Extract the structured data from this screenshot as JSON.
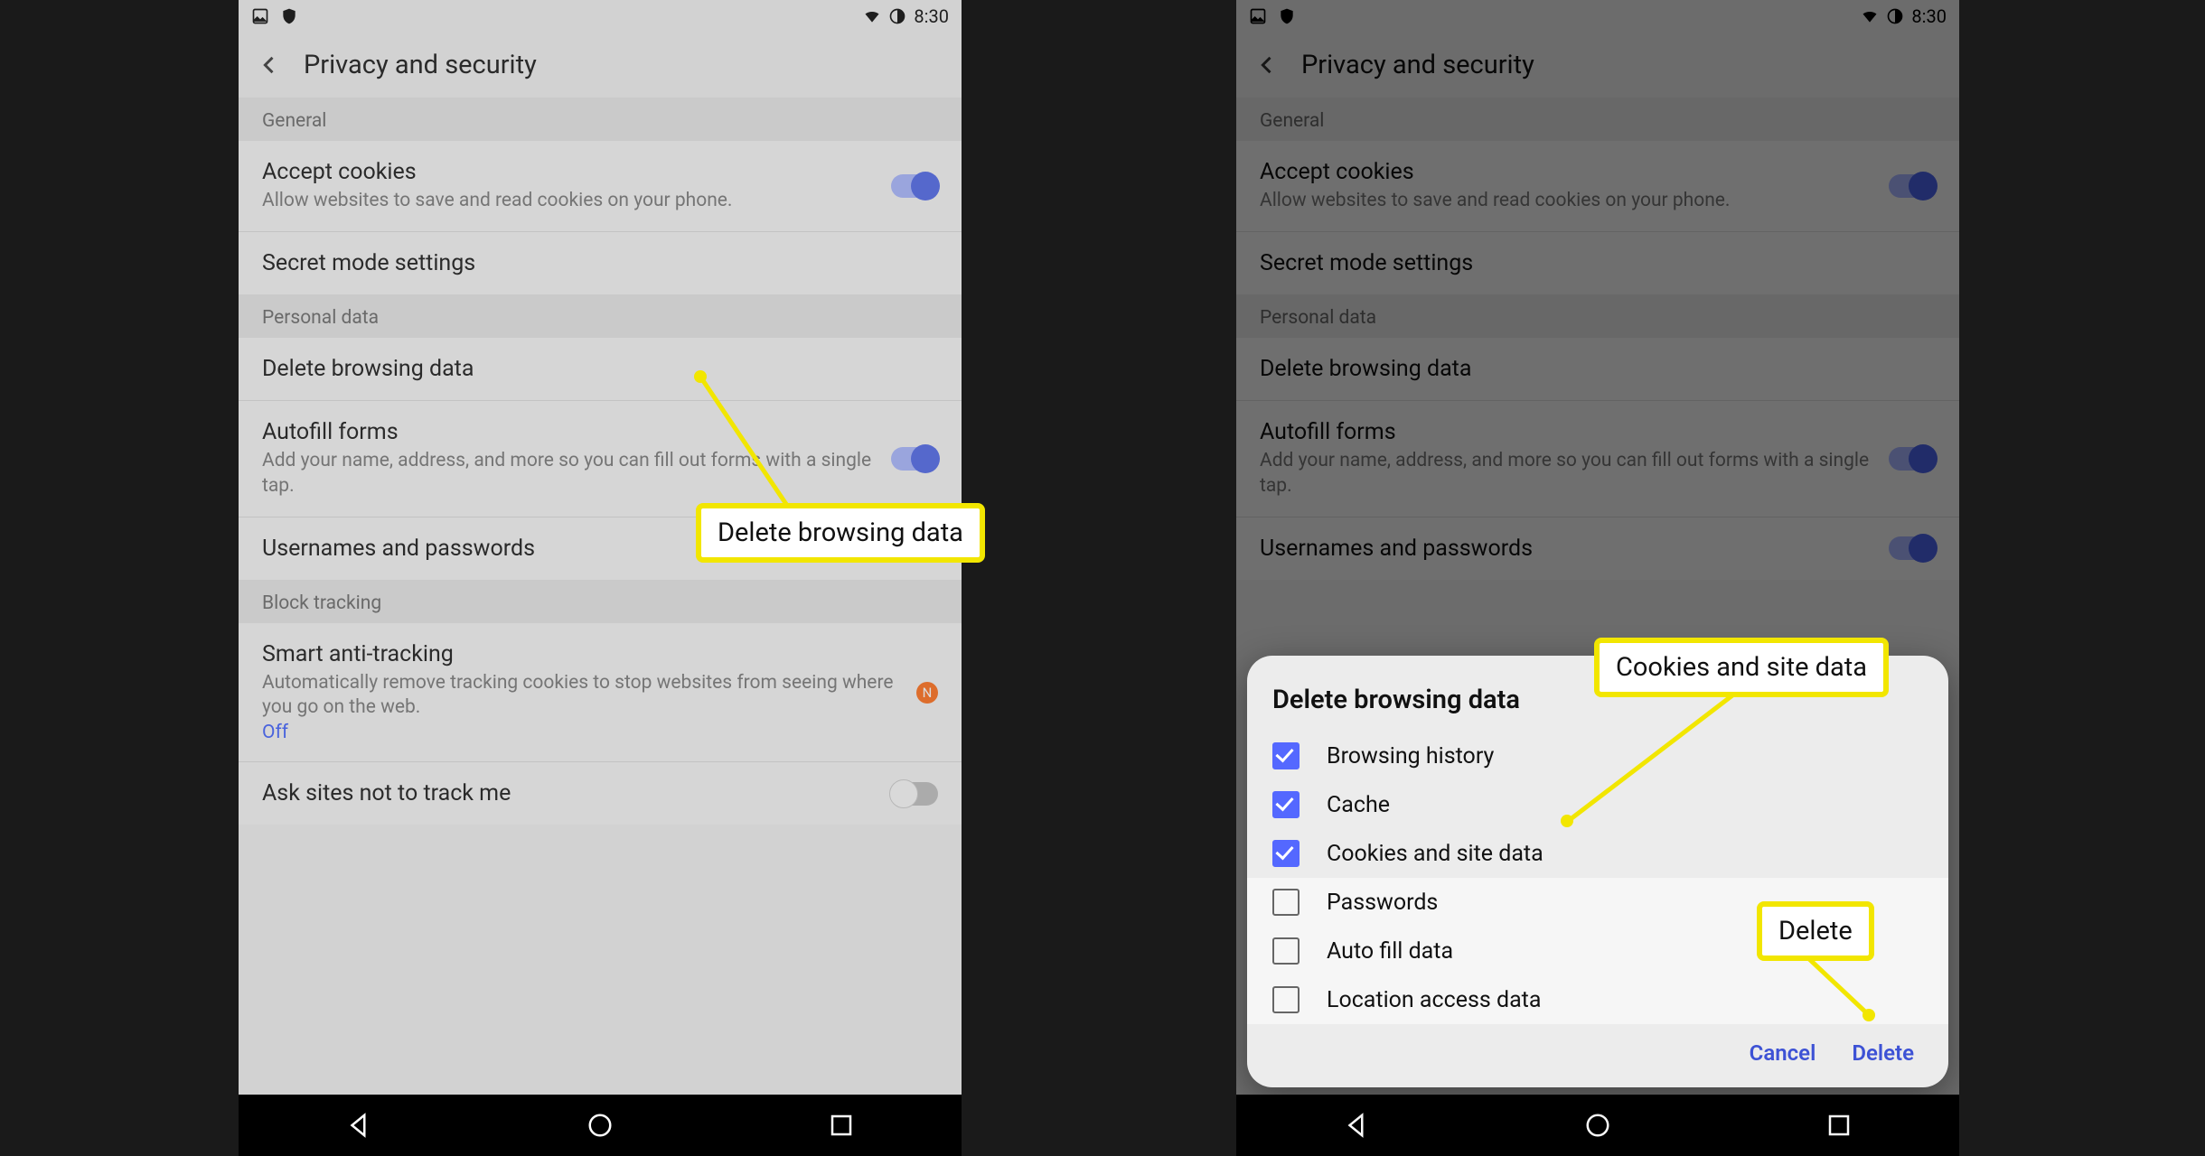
{
  "status": {
    "time": "8:30"
  },
  "appbar": {
    "title": "Privacy and security"
  },
  "sections": {
    "general": "General",
    "personal": "Personal data",
    "block": "Block tracking"
  },
  "rows": {
    "cookies": {
      "title": "Accept cookies",
      "sub": "Allow websites to save and read cookies on your phone."
    },
    "secret": {
      "title": "Secret mode settings"
    },
    "delete": {
      "title": "Delete browsing data"
    },
    "autofill": {
      "title": "Autofill forms",
      "sub": "Add your name, address, and more so you can fill out forms with a single tap."
    },
    "userpw": {
      "title": "Usernames and passwords"
    },
    "smart": {
      "title": "Smart anti-tracking",
      "sub": "Automatically remove tracking cookies to stop websites from seeing where you go on the web.",
      "status": "Off"
    },
    "dnt": {
      "title": "Ask sites not to track me"
    }
  },
  "dialog": {
    "title": "Delete browsing data",
    "items": {
      "history": "Browsing history",
      "cache": "Cache",
      "cookies": "Cookies and site data",
      "pw": "Passwords",
      "autofill": "Auto fill data",
      "location": "Location access data"
    },
    "cancel": "Cancel",
    "delete": "Delete"
  },
  "callouts": {
    "deleteBrowsing": "Delete browsing data",
    "cookiesSite": "Cookies and site data",
    "deleteBtn": "Delete"
  },
  "badge_n": "N"
}
